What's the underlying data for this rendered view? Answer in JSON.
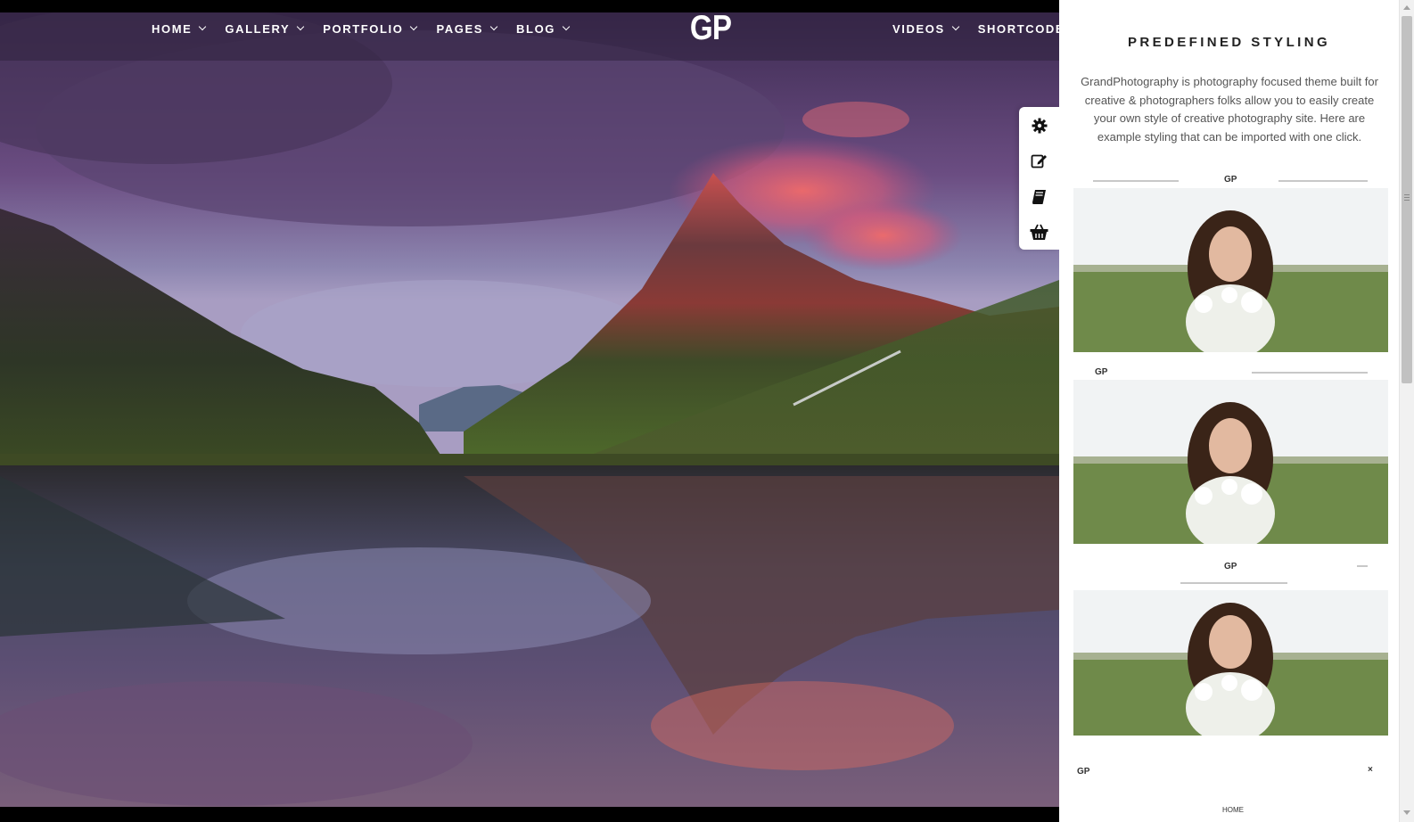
{
  "nav": {
    "left": [
      {
        "label": "HOME"
      },
      {
        "label": "GALLERY"
      },
      {
        "label": "PORTFOLIO"
      },
      {
        "label": "PAGES"
      },
      {
        "label": "BLOG"
      }
    ],
    "logo": "GP",
    "right": [
      {
        "label": "VIDEOS"
      },
      {
        "label": "SHORTCODES"
      }
    ]
  },
  "tools": [
    "gear-icon",
    "edit-icon",
    "book-icon",
    "basket-icon"
  ],
  "panel": {
    "title": "PREDEFINED STYLING",
    "description": "GrandPhotography is photography focused theme built for creative & photographers folks allow you to easily create your own style of creative photography site. Here are example styling that can be imported with one click.",
    "thumbs": [
      {
        "logo": "GP"
      },
      {
        "logo": "GP"
      },
      {
        "logo": "GP"
      },
      {
        "logo": "GP",
        "close": "×",
        "menu_label": "HOME"
      }
    ]
  },
  "colors": {
    "nav_overlay": "#30223e",
    "panel_bg": "#ffffff",
    "title": "#222222",
    "text": "#555555"
  }
}
